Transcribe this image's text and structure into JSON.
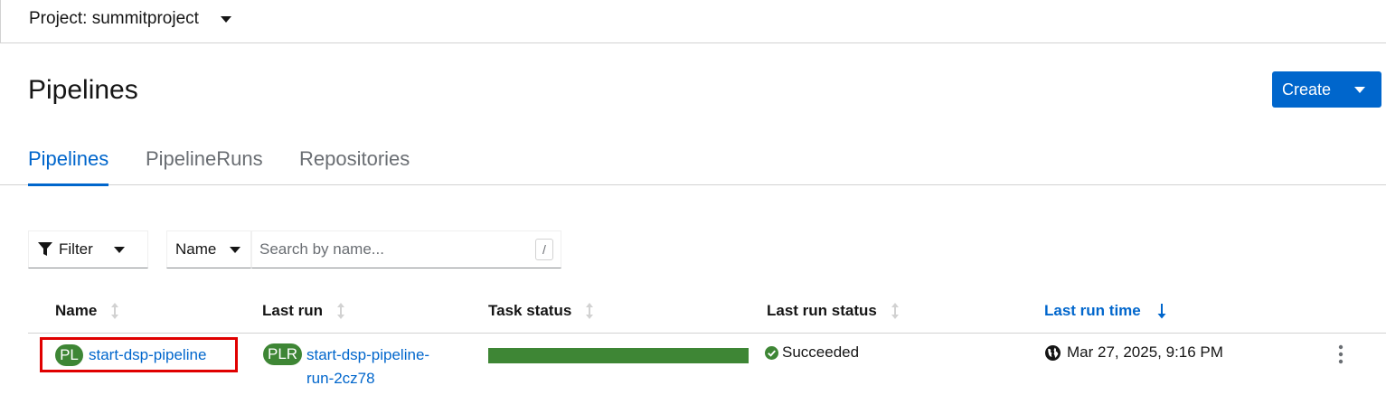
{
  "project": {
    "label": "Project: summitproject"
  },
  "page": {
    "title": "Pipelines"
  },
  "create_button": {
    "label": "Create"
  },
  "tabs": [
    {
      "label": "Pipelines",
      "active": true
    },
    {
      "label": "PipelineRuns",
      "active": false
    },
    {
      "label": "Repositories",
      "active": false
    }
  ],
  "toolbar": {
    "filter_label": "Filter",
    "attribute_label": "Name",
    "search_placeholder": "Search by name...",
    "search_shortcut": "/"
  },
  "table": {
    "columns": [
      {
        "label": "Name",
        "sorted": false
      },
      {
        "label": "Last run",
        "sorted": false
      },
      {
        "label": "Task status",
        "sorted": false
      },
      {
        "label": "Last run status",
        "sorted": false
      },
      {
        "label": "Last run time",
        "sorted": true,
        "direction": "descending"
      }
    ],
    "rows": [
      {
        "name_badge": "PL",
        "name": "start-dsp-pipeline",
        "last_run_badge": "PLR",
        "last_run_line1": "start-dsp-pipeline-",
        "last_run_line2": "run-2cz78",
        "task_status_fraction": 1.0,
        "last_run_status": "Succeeded",
        "last_run_time": "Mar 27, 2025, 9:16 PM"
      }
    ]
  },
  "colors": {
    "accent": "#0066cc",
    "success": "#3e8635",
    "highlight_outline": "#e00000"
  },
  "icons": {
    "filter": "funnel-icon",
    "sort": "sort-icon",
    "sorted_desc": "arrow-down-icon",
    "status": "check-circle-icon",
    "time": "globe-icon",
    "row_actions": "kebab-icon"
  }
}
